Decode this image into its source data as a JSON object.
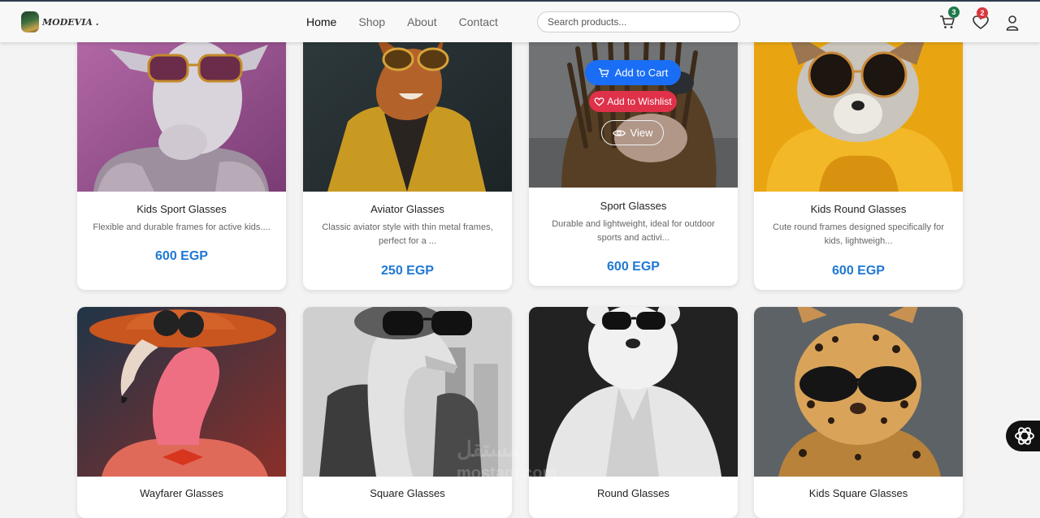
{
  "brand": {
    "name": "MODEVIA ."
  },
  "nav": {
    "links": [
      "Home",
      "Shop",
      "About",
      "Contact"
    ],
    "active": "Home"
  },
  "search": {
    "placeholder": "Search products..."
  },
  "cart": {
    "count": "3",
    "badge_color": "#1f7a4a"
  },
  "wishlist": {
    "count": "2",
    "badge_color": "#d9363e"
  },
  "hover_actions": {
    "add_to_cart": "Add to Cart",
    "add_to_wishlist": "Add to Wishlist",
    "view": "View"
  },
  "products": [
    {
      "title": "Kids Sport Glasses",
      "desc": "Flexible and durable frames for active kids....",
      "price": "600 EGP",
      "image": "goat-with-sunglasses"
    },
    {
      "title": "Aviator Glasses",
      "desc": "Classic aviator style with thin metal frames, perfect for a ...",
      "price": "250 EGP",
      "image": "fox-with-aviators"
    },
    {
      "title": "Sport Glasses",
      "desc": "Durable and lightweight, ideal for outdoor sports and activi...",
      "price": "600 EGP",
      "image": "hedgehog-with-dreadlocks"
    },
    {
      "title": "Kids Round Glasses",
      "desc": "Cute round frames designed specifically for kids, lightweigh...",
      "price": "600 EGP",
      "image": "fox-with-round-glasses"
    },
    {
      "title": "Wayfarer Glasses",
      "image": "flamingo-with-hat"
    },
    {
      "title": "Square Glasses",
      "image": "goose-in-jacket"
    },
    {
      "title": "Round Glasses",
      "image": "polar-bear-in-robe"
    },
    {
      "title": "Kids Square Glasses",
      "image": "leopard-with-sunglasses"
    }
  ],
  "watermark": {
    "arabic": "مستقل",
    "latin": "mostaqi.com"
  },
  "colors": {
    "price": "#1f78d4",
    "cart_button": "#1a6ef5",
    "wishlist_button": "#e0314a"
  }
}
